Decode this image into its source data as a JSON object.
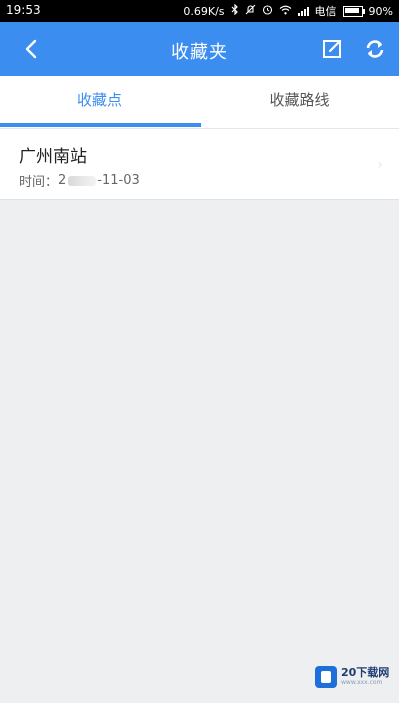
{
  "status_bar": {
    "time": "19:53",
    "speed": "0.69K/s",
    "carrier": "电信",
    "battery": "90%",
    "icons": [
      "bluetooth-icon",
      "mute-icon",
      "alarm-icon",
      "wifi-icon",
      "signal-icon",
      "battery-icon"
    ]
  },
  "header": {
    "title": "收藏夹",
    "back_icon": "chevron-left-icon",
    "edit_icon": "edit-icon",
    "refresh_icon": "refresh-icon",
    "color": "#3b8df0"
  },
  "tabs": [
    {
      "label": "收藏点",
      "active": true
    },
    {
      "label": "收藏路线",
      "active": false
    }
  ],
  "favorites": [
    {
      "name": "广州南站",
      "time_label": "时间：",
      "date_prefix": "2",
      "date_suffix": "-11-03"
    }
  ],
  "watermark": {
    "text": "20下载网",
    "sub": "www.xxx.com"
  }
}
